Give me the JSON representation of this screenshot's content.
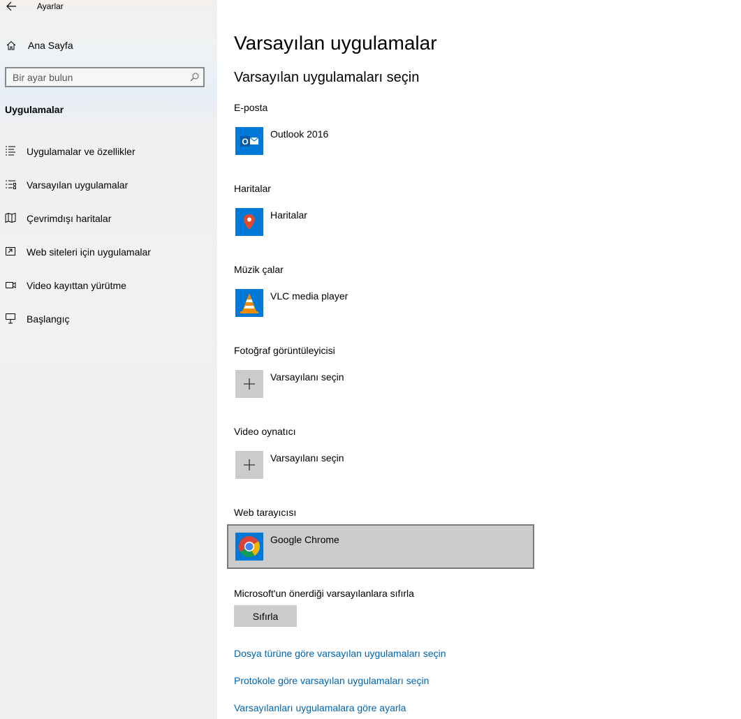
{
  "window": {
    "title": "Ayarlar"
  },
  "sidebar": {
    "home_label": "Ana Sayfa",
    "search_placeholder": "Bir ayar bulun",
    "section_title": "Uygulamalar",
    "items": [
      {
        "label": "Uygulamalar ve özellikler",
        "icon": "apps-features-icon"
      },
      {
        "label": "Varsayılan uygulamalar",
        "icon": "default-apps-icon"
      },
      {
        "label": "Çevrimdışı haritalar",
        "icon": "offline-maps-icon"
      },
      {
        "label": "Web siteleri için uygulamalar",
        "icon": "apps-for-websites-icon"
      },
      {
        "label": "Video kayıttan yürütme",
        "icon": "video-playback-icon"
      },
      {
        "label": "Başlangıç",
        "icon": "startup-icon"
      }
    ]
  },
  "main": {
    "title": "Varsayılan uygulamalar",
    "subtitle": "Varsayılan uygulamaları seçin",
    "categories": [
      {
        "label": "E-posta",
        "app": "Outlook 2016",
        "icon": "outlook-icon"
      },
      {
        "label": "Haritalar",
        "app": "Haritalar",
        "icon": "maps-icon"
      },
      {
        "label": "Müzik çalar",
        "app": "VLC media player",
        "icon": "vlc-icon"
      },
      {
        "label": "Fotoğraf görüntüleyicisi",
        "app": "Varsayılanı seçin",
        "icon": "plus-icon"
      },
      {
        "label": "Video oynatıcı",
        "app": "Varsayılanı seçin",
        "icon": "plus-icon"
      },
      {
        "label": "Web tarayıcısı",
        "app": "Google Chrome",
        "icon": "chrome-icon"
      }
    ],
    "reset_label": "Microsoft'un önerdiği varsayılanlara sıfırla",
    "reset_button": "Sıfırla",
    "links": [
      "Dosya türüne göre varsayılan uygulamaları seçin",
      "Protokole göre varsayılan uygulamaları seçin",
      "Varsayılanları uygulamalara göre ayarla"
    ]
  },
  "colors": {
    "accent": "#0078d7",
    "link": "#0063b1",
    "selected_bg": "#cccccc",
    "placeholder_tile": "#cccccc"
  }
}
